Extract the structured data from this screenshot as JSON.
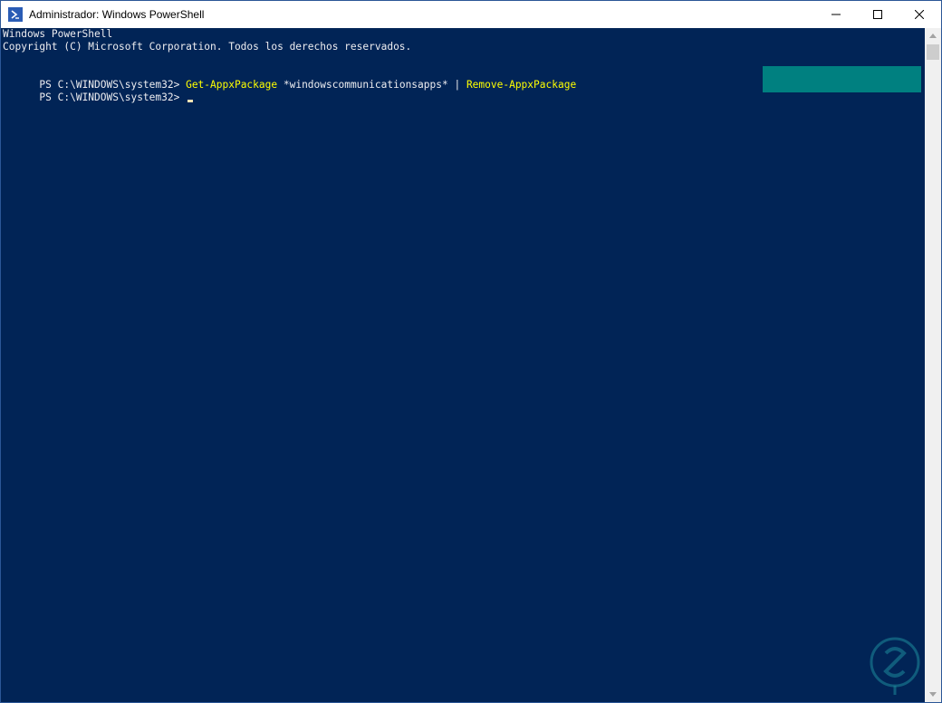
{
  "window": {
    "title": "Administrador: Windows PowerShell",
    "icons": {
      "app": "powershell-icon",
      "minimize": "minimize-icon",
      "maximize": "maximize-icon",
      "close": "close-icon"
    }
  },
  "console": {
    "colors": {
      "background": "#012456",
      "text": "#eeedf0",
      "command": "#ffff00",
      "highlight": "#008080"
    },
    "lines": [
      {
        "text": "Windows PowerShell"
      },
      {
        "text": "Copyright (C) Microsoft Corporation. Todos los derechos reservados."
      },
      {
        "text": ""
      },
      {
        "prompt": "PS C:\\WINDOWS\\system32> ",
        "cmd1": "Get-AppxPackage",
        "arg": " *windowscommunicationsapps* | ",
        "cmd2": "Remove-AppxPackage"
      },
      {
        "prompt": "PS C:\\WINDOWS\\system32> "
      }
    ]
  },
  "scrollbar": {
    "icons": {
      "up": "scroll-up-arrow-icon",
      "down": "scroll-down-arrow-icon"
    }
  },
  "watermark": {
    "icon": "watermark-logo-icon",
    "accent": "#1e8a9c"
  }
}
